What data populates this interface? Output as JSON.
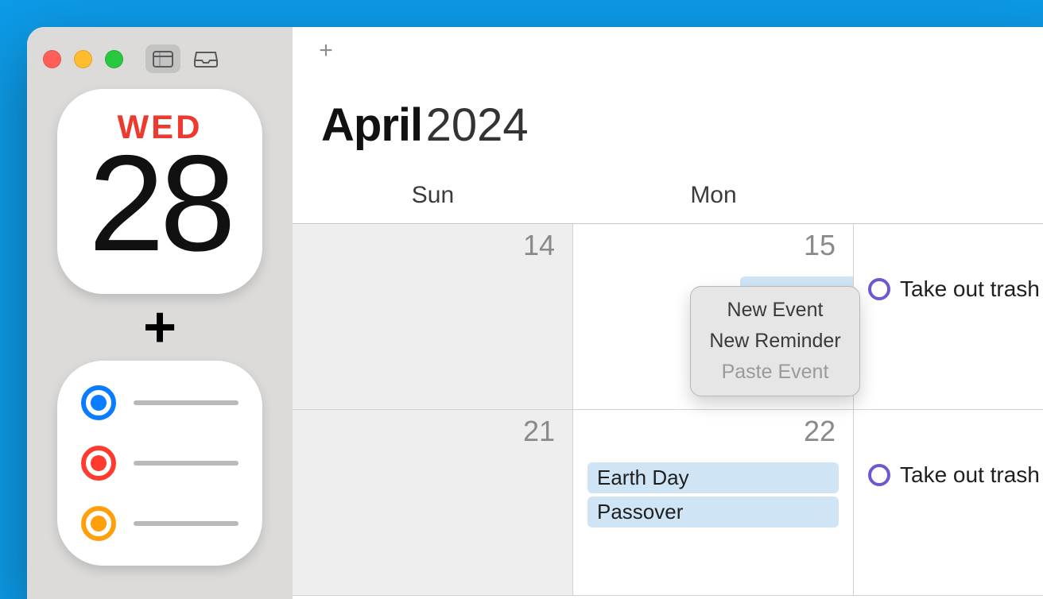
{
  "sidebar": {
    "calendar_icon": {
      "weekday": "WED",
      "day": "28"
    }
  },
  "toolbar": {
    "add_label": "+"
  },
  "header": {
    "month": "April",
    "year": "2024"
  },
  "weekdays": [
    "Sun",
    "Mon"
  ],
  "rows": [
    {
      "cells": [
        {
          "day": "14"
        },
        {
          "day": "15"
        },
        {
          "reminder": "Take out trash"
        }
      ]
    },
    {
      "cells": [
        {
          "day": "21"
        },
        {
          "day": "22",
          "events": [
            "Earth Day",
            "Passover"
          ]
        },
        {
          "reminder": "Take out trash"
        }
      ]
    }
  ],
  "context_menu": {
    "items": [
      {
        "label": "New Event",
        "enabled": true
      },
      {
        "label": "New Reminder",
        "enabled": true
      },
      {
        "label": "Paste Event",
        "enabled": false
      }
    ]
  }
}
